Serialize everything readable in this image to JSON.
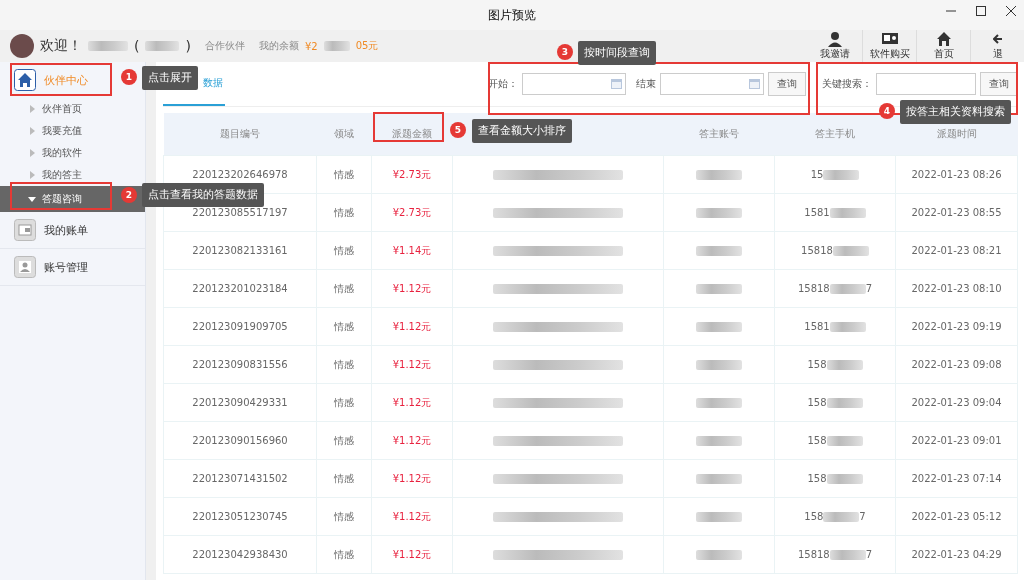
{
  "window": {
    "title": "图片预览"
  },
  "header": {
    "welcome": "欢迎！",
    "open_paren": "(",
    "close_paren": ")",
    "role": "合作伙伴",
    "balance_label": "我的余额",
    "balance_prefix": "¥2",
    "balance_suffix": "05元"
  },
  "toolbar": [
    {
      "label": "我邀请",
      "kind": "person"
    },
    {
      "label": "软件购买",
      "kind": "software"
    },
    {
      "label": "首页",
      "kind": "home"
    },
    {
      "label": "退",
      "kind": "exit"
    }
  ],
  "sidebar": {
    "items": [
      {
        "label": "伙伴中心",
        "kind": "home",
        "expanded": true,
        "children": [
          {
            "label": "伙伴首页",
            "selected": false
          },
          {
            "label": "我要充值",
            "selected": false
          },
          {
            "label": "我的软件",
            "selected": false
          },
          {
            "label": "我的答主",
            "selected": false
          },
          {
            "label": "答题咨询",
            "selected": true
          }
        ]
      },
      {
        "label": "我的账单",
        "kind": "wallet",
        "expanded": false
      },
      {
        "label": "账号管理",
        "kind": "account",
        "expanded": false
      }
    ]
  },
  "tabs": [
    {
      "label": "数据",
      "selected": true
    }
  ],
  "filters": {
    "start_label": "开始：",
    "end_label": "结束",
    "query_button": "查询",
    "keyword_label": "关键搜索：",
    "keyword_button": "查询"
  },
  "table": {
    "columns": [
      "题目编号",
      "领域",
      "派题金额",
      "",
      "答主账号",
      "答主手机",
      "派题时间"
    ],
    "rows": [
      {
        "id": "220123202646978",
        "domain": "情感",
        "amount": "¥2.73元",
        "phone": "15",
        "phone_end": "",
        "time": "2022-01-23 08:26"
      },
      {
        "id": "220123085517197",
        "domain": "情感",
        "amount": "¥2.73元",
        "phone": "1581",
        "phone_end": "",
        "time": "2022-01-23 08:55"
      },
      {
        "id": "220123082133161",
        "domain": "情感",
        "amount": "¥1.14元",
        "phone": "15818",
        "phone_end": "",
        "time": "2022-01-23 08:21"
      },
      {
        "id": "220123201023184",
        "domain": "情感",
        "amount": "¥1.12元",
        "phone": "15818",
        "phone_end": "7",
        "time": "2022-01-23 08:10"
      },
      {
        "id": "220123091909705",
        "domain": "情感",
        "amount": "¥1.12元",
        "phone": "1581",
        "phone_end": "",
        "time": "2022-01-23 09:19"
      },
      {
        "id": "220123090831556",
        "domain": "情感",
        "amount": "¥1.12元",
        "phone": "158",
        "phone_end": "",
        "time": "2022-01-23 09:08"
      },
      {
        "id": "220123090429331",
        "domain": "情感",
        "amount": "¥1.12元",
        "phone": "158",
        "phone_end": "",
        "time": "2022-01-23 09:04"
      },
      {
        "id": "220123090156960",
        "domain": "情感",
        "amount": "¥1.12元",
        "phone": "158",
        "phone_end": "",
        "time": "2022-01-23 09:01"
      },
      {
        "id": "220123071431502",
        "domain": "情感",
        "amount": "¥1.12元",
        "phone": "158",
        "phone_end": "",
        "time": "2022-01-23 07:14"
      },
      {
        "id": "220123051230745",
        "domain": "情感",
        "amount": "¥1.12元",
        "phone": "158",
        "phone_end": "7",
        "time": "2022-01-23 05:12"
      },
      {
        "id": "220123042938430",
        "domain": "情感",
        "amount": "¥1.12元",
        "phone": "15818",
        "phone_end": "7",
        "time": "2022-01-23 04:29"
      }
    ]
  },
  "annotations": [
    {
      "number": "1",
      "text": "点击展开"
    },
    {
      "number": "2",
      "text": "点击查看我的答题数据"
    },
    {
      "number": "3",
      "text": "按时间段查询"
    },
    {
      "number": "4",
      "text": "按答主相关资料搜索"
    },
    {
      "number": "5",
      "text": "查看金额大小排序"
    }
  ]
}
